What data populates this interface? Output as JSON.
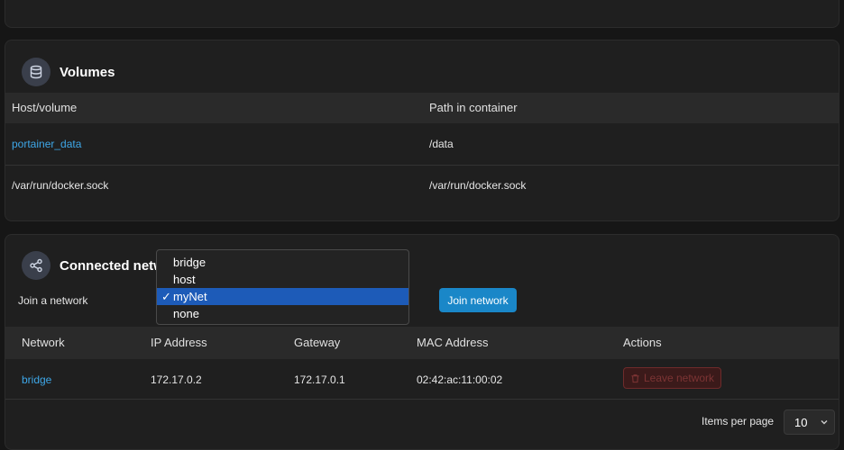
{
  "volumes": {
    "title": "Volumes",
    "icon": "database-icon",
    "columns": [
      "Host/volume",
      "Path in container"
    ],
    "rows": [
      {
        "host": "portainer_data",
        "path": "/data"
      },
      {
        "host": "/var/run/docker.sock",
        "path": "/var/run/docker.sock"
      }
    ]
  },
  "networks": {
    "title": "Connected networks",
    "icon": "share-icon",
    "join_label": "Join a network",
    "join_button": "Join network",
    "dropdown": {
      "options": [
        "bridge",
        "host",
        "myNet",
        "none"
      ],
      "selected": "myNet"
    },
    "columns": [
      "Network",
      "IP Address",
      "Gateway",
      "MAC Address",
      "Actions"
    ],
    "rows": [
      {
        "network": "bridge",
        "ip": "172.17.0.2",
        "gateway": "172.17.0.1",
        "mac": "02:42:ac:11:00:02",
        "action": "Leave network"
      }
    ],
    "items_per_page_label": "Items per page",
    "items_per_page": "10"
  },
  "colors": {
    "link": "#3ea7e8",
    "primary_button": "#1a87c8",
    "danger_button_bg": "#3b1a1a",
    "selected_option": "#1d5bb8"
  }
}
